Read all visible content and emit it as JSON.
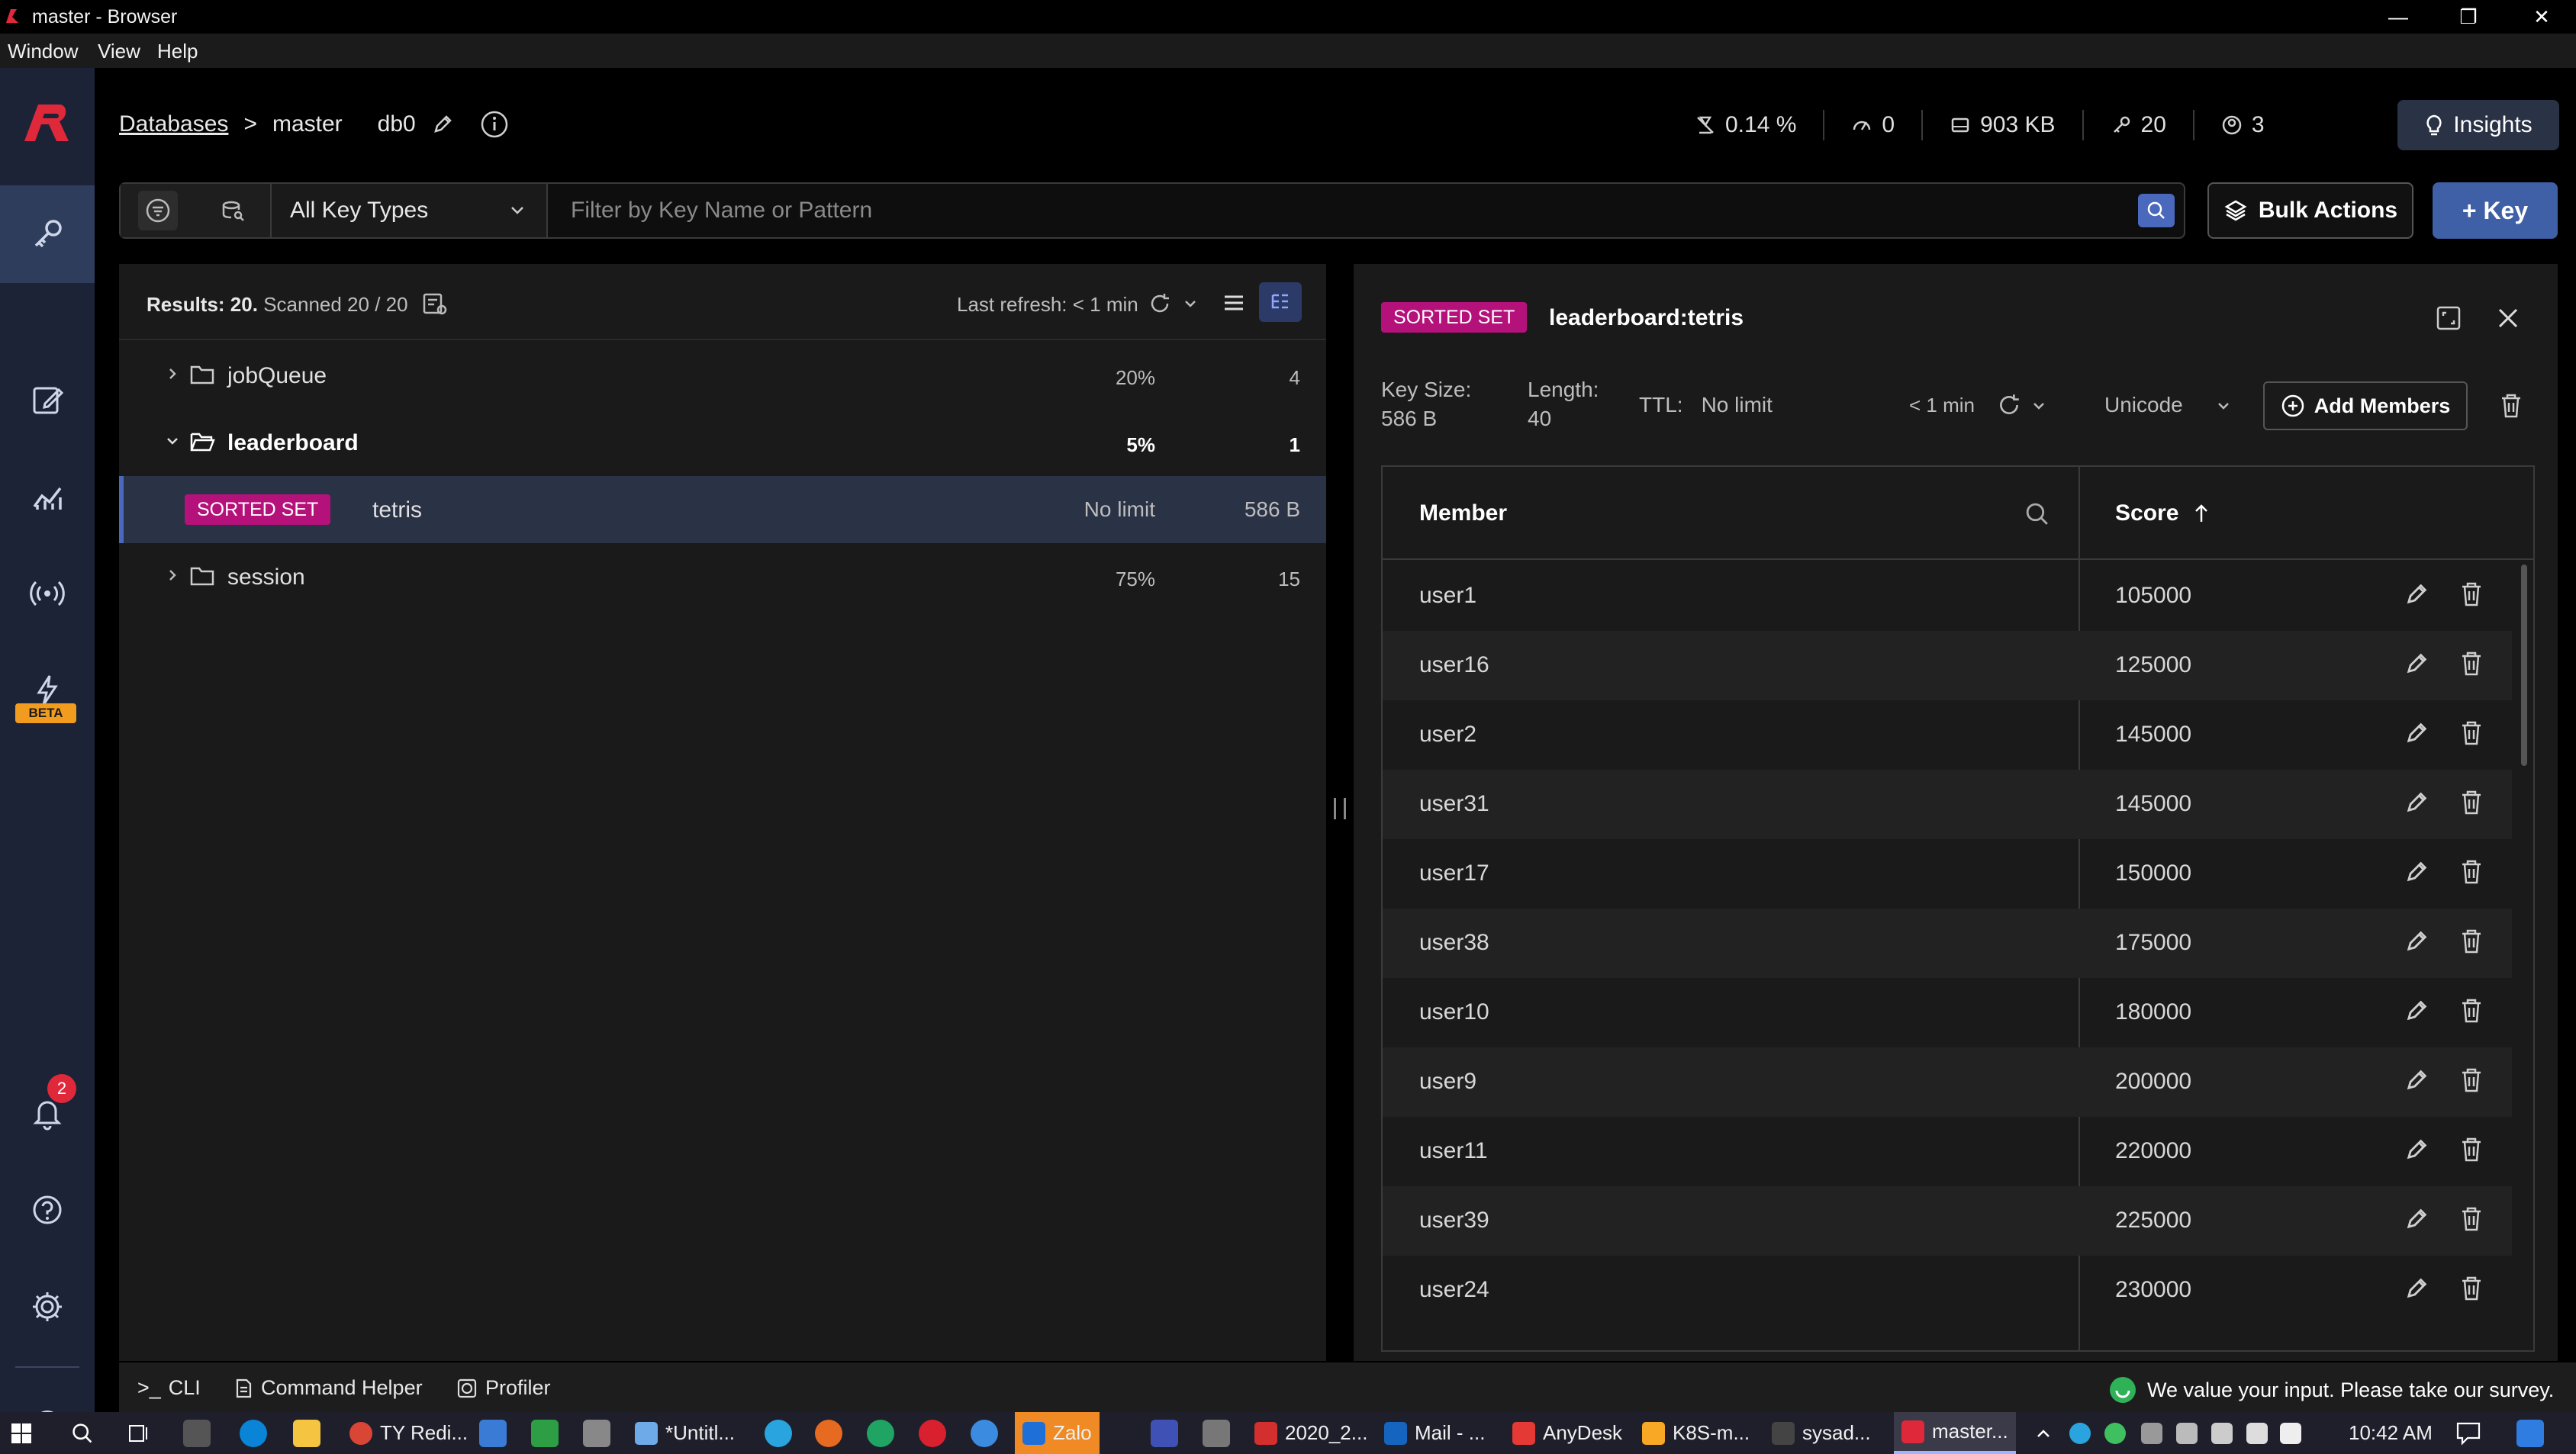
{
  "window": {
    "title": "master - Browser",
    "menu": [
      "Window",
      "View",
      "Help"
    ]
  },
  "breadcrumb": {
    "databases": "Databases",
    "separator": ">",
    "instance": "master",
    "db": "db0"
  },
  "stats": {
    "cpu": "0.14 %",
    "ops": "0",
    "memory": "903 KB",
    "keys": "20",
    "clients": "3"
  },
  "insights_label": "Insights",
  "filter": {
    "key_type": "All Key Types",
    "placeholder": "Filter by Key Name or Pattern"
  },
  "actions": {
    "bulk": "Bulk Actions",
    "add_key": "+ Key"
  },
  "keylist": {
    "results_label": "Results: 20.",
    "scanned": "Scanned 20 / 20",
    "last_refresh": "Last refresh: < 1 min",
    "rows": [
      {
        "name": "jobQueue",
        "pct": "20%",
        "count": "4"
      },
      {
        "name": "leaderboard",
        "pct": "5%",
        "count": "1"
      },
      {
        "badge": "SORTED SET",
        "name": "tetris",
        "ttl": "No limit",
        "size": "586 B"
      },
      {
        "name": "session",
        "pct": "75%",
        "count": "15"
      }
    ]
  },
  "details": {
    "badge": "SORTED SET",
    "key": "leaderboard:tetris",
    "key_size_label": "Key Size:",
    "key_size": "586 B",
    "length_label": "Length:",
    "length": "40",
    "ttl_label": "TTL:",
    "ttl": "No limit",
    "refresh": "< 1 min",
    "encoding": "Unicode",
    "add_members": "Add Members",
    "col_member": "Member",
    "col_score": "Score",
    "members": [
      {
        "member": "user1",
        "score": "105000"
      },
      {
        "member": "user16",
        "score": "125000"
      },
      {
        "member": "user2",
        "score": "145000"
      },
      {
        "member": "user31",
        "score": "145000"
      },
      {
        "member": "user17",
        "score": "150000"
      },
      {
        "member": "user38",
        "score": "175000"
      },
      {
        "member": "user10",
        "score": "180000"
      },
      {
        "member": "user9",
        "score": "200000"
      },
      {
        "member": "user11",
        "score": "220000"
      },
      {
        "member": "user39",
        "score": "225000"
      },
      {
        "member": "user24",
        "score": "230000"
      }
    ]
  },
  "notifications_count": "2",
  "beta_label": "BETA",
  "bottombar": {
    "cli": "CLI",
    "command_helper": "Command Helper",
    "profiler": "Profiler",
    "survey": "We value your input. Please take our survey."
  },
  "taskbar": {
    "apps": [
      "TY Redi...",
      "*Untitl...",
      "Zalo",
      "2020_2...",
      "Mail - ...",
      "AnyDesk",
      "K8S-m...",
      "sysad...",
      "master..."
    ],
    "time": "10:42 AM"
  },
  "colors": {
    "accent": "#4a69bd",
    "badge_sorted_set": "#b5117a",
    "nav_bg": "#1d2336"
  }
}
